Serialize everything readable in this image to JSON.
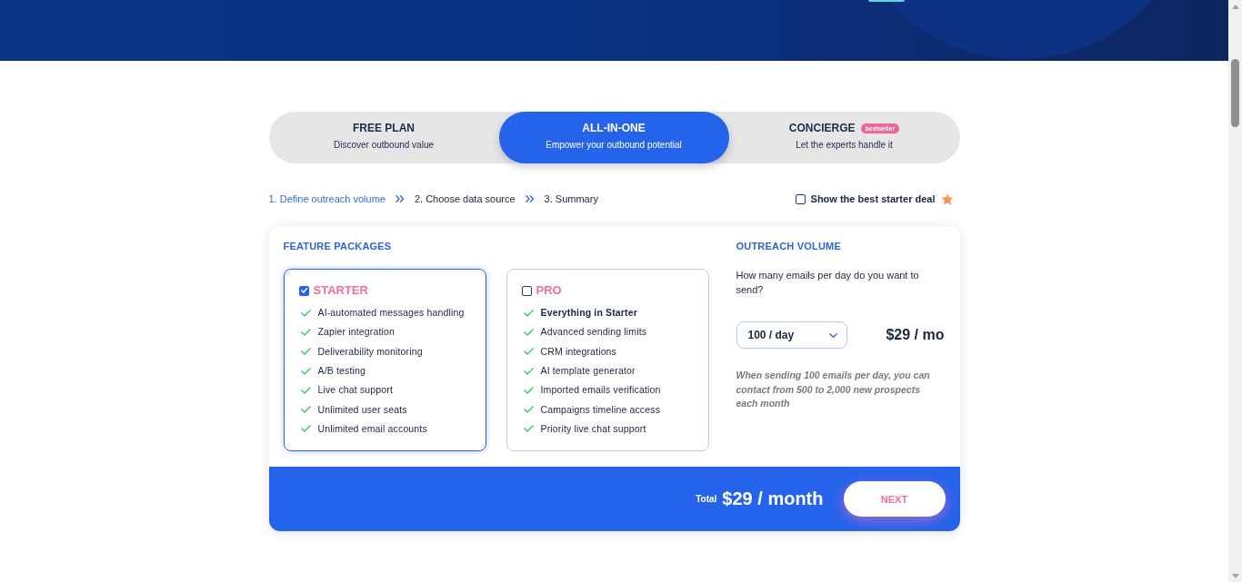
{
  "plan_tabs": [
    {
      "title": "FREE PLAN",
      "subtitle": "Discover outbound value",
      "selected": false
    },
    {
      "title": "ALL-IN-ONE",
      "subtitle": "Empower your outbound potential",
      "selected": true
    },
    {
      "title": "CONCIERGE",
      "subtitle": "Let the experts handle it",
      "badge": "bestseller",
      "selected": false
    }
  ],
  "steps": [
    {
      "label": "1. Define outreach volume",
      "selected": true
    },
    {
      "label": "2. Choose data source",
      "selected": false
    },
    {
      "label": "3. Summary",
      "selected": false
    }
  ],
  "starter_deal": {
    "label": "Show the best starter deal",
    "checked": false
  },
  "feature_packages": {
    "heading": "FEATURE PACKAGES",
    "packages": [
      {
        "name": "STARTER",
        "checked": true,
        "features": [
          {
            "text": "AI-automated messages handling",
            "bold": false
          },
          {
            "text": "Zapier integration",
            "bold": false
          },
          {
            "text": "Deliverability monitoring",
            "bold": false
          },
          {
            "text": "A/B testing",
            "bold": false
          },
          {
            "text": "Live chat support",
            "bold": false
          },
          {
            "text": "Unlimited user seats",
            "bold": false
          },
          {
            "text": "Unlimited email accounts",
            "bold": false
          }
        ]
      },
      {
        "name": "PRO",
        "checked": false,
        "features": [
          {
            "text": "Everything in Starter",
            "bold": true
          },
          {
            "text": "Advanced sending limits",
            "bold": false
          },
          {
            "text": "CRM integrations",
            "bold": false
          },
          {
            "text": "AI template generator",
            "bold": false
          },
          {
            "text": "Imported emails verification",
            "bold": false
          },
          {
            "text": "Campaigns timeline access",
            "bold": false
          },
          {
            "text": "Priority live chat support",
            "bold": false
          }
        ]
      }
    ]
  },
  "outreach_volume": {
    "heading": "OUTREACH VOLUME",
    "question": "How many emails per day do you want to send?",
    "select": {
      "value": "100 / day"
    },
    "price": "$29 / mo",
    "note": "When sending 100 emails per day, you can contact from 500 to 2,000 new prospects each month"
  },
  "footer": {
    "total_label": "Total",
    "total": "$29 / month",
    "next_button": "NEXT"
  }
}
